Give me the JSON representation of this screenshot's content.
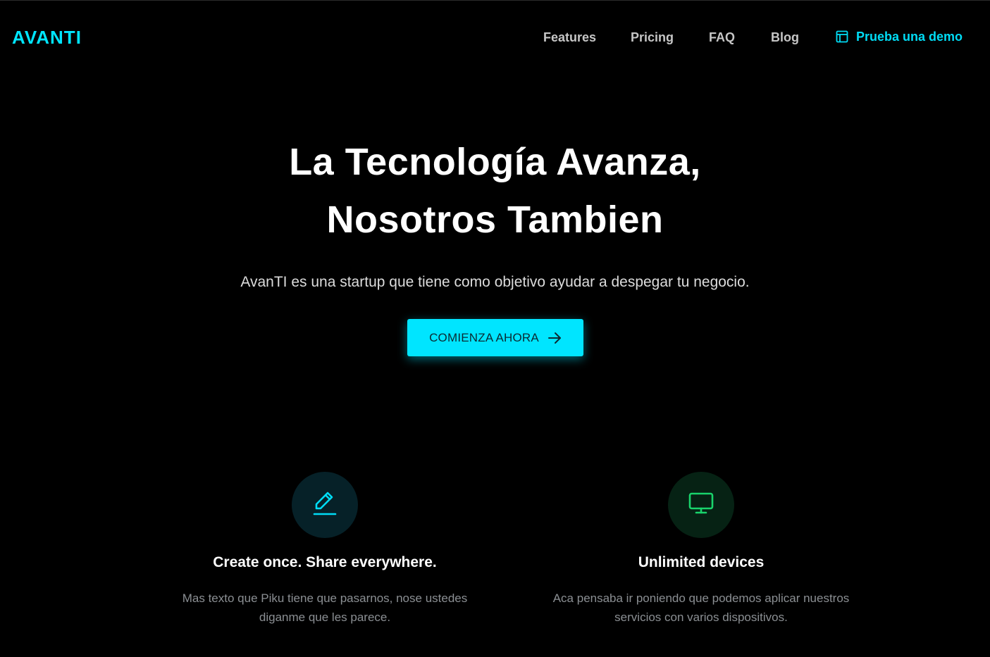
{
  "brand": {
    "logo_text": "AVANTI",
    "accent_color": "#00e5ff",
    "feature_green": "#19d36b"
  },
  "nav": {
    "items": [
      {
        "label": "Features"
      },
      {
        "label": "Pricing"
      },
      {
        "label": "FAQ"
      },
      {
        "label": "Blog"
      }
    ],
    "demo": {
      "label": "Prueba una demo",
      "icon": "layout-icon"
    }
  },
  "hero": {
    "title_line1": "La Tecnología Avanza,",
    "title_line2": "Nosotros Tambien",
    "subtitle": "AvanTI es una startup que tiene como objetivo ayudar a despegar tu negocio.",
    "cta_label": "COMIENZA AHORA",
    "cta_icon": "arrow-right-icon"
  },
  "features": [
    {
      "icon": "pencil-icon",
      "title": "Create once. Share everywhere.",
      "text": "Mas texto que Piku tiene que pasarnos, nose ustedes diganme que les parece."
    },
    {
      "icon": "monitor-icon",
      "title": "Unlimited devices",
      "text": "Aca pensaba ir poniendo que podemos aplicar nuestros servicios con varios dispositivos."
    }
  ]
}
